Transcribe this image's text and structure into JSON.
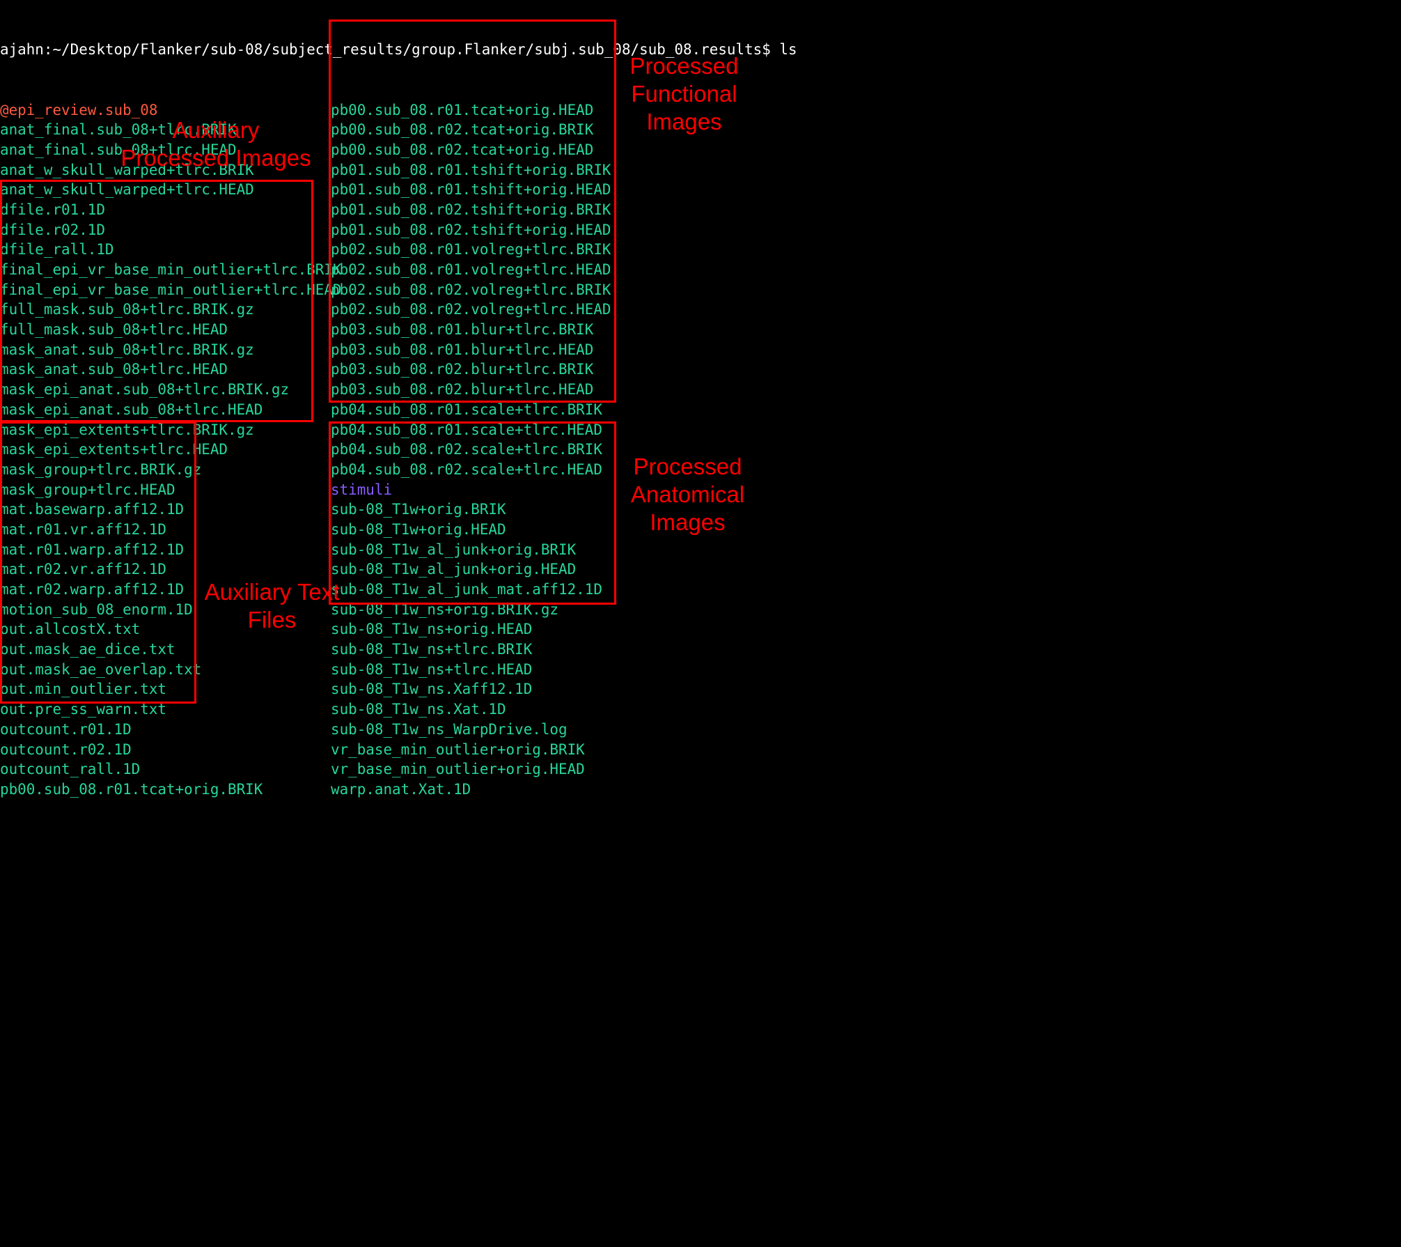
{
  "prompt": "ajahn:~/Desktop/Flanker/sub-08/subject_results/group.Flanker/subj.sub_08/sub_08.results$ ",
  "command": "ls",
  "col1": [
    {
      "t": "@epi_review.sub_08",
      "c": "exec"
    },
    {
      "t": "anat_final.sub_08+tlrc.BRIK",
      "c": "file"
    },
    {
      "t": "anat_final.sub_08+tlrc.HEAD",
      "c": "file"
    },
    {
      "t": "anat_w_skull_warped+tlrc.BRIK",
      "c": "file"
    },
    {
      "t": "anat_w_skull_warped+tlrc.HEAD",
      "c": "file"
    },
    {
      "t": "dfile.r01.1D",
      "c": "file"
    },
    {
      "t": "dfile.r02.1D",
      "c": "file"
    },
    {
      "t": "dfile_rall.1D",
      "c": "file"
    },
    {
      "t": "final_epi_vr_base_min_outlier+tlrc.BRIK",
      "c": "file"
    },
    {
      "t": "final_epi_vr_base_min_outlier+tlrc.HEAD",
      "c": "file"
    },
    {
      "t": "full_mask.sub_08+tlrc.BRIK.gz",
      "c": "file"
    },
    {
      "t": "full_mask.sub_08+tlrc.HEAD",
      "c": "file"
    },
    {
      "t": "mask_anat.sub_08+tlrc.BRIK.gz",
      "c": "file"
    },
    {
      "t": "mask_anat.sub_08+tlrc.HEAD",
      "c": "file"
    },
    {
      "t": "mask_epi_anat.sub_08+tlrc.BRIK.gz",
      "c": "file"
    },
    {
      "t": "mask_epi_anat.sub_08+tlrc.HEAD",
      "c": "file"
    },
    {
      "t": "mask_epi_extents+tlrc.BRIK.gz",
      "c": "file"
    },
    {
      "t": "mask_epi_extents+tlrc.HEAD",
      "c": "file"
    },
    {
      "t": "mask_group+tlrc.BRIK.gz",
      "c": "file"
    },
    {
      "t": "mask_group+tlrc.HEAD",
      "c": "file"
    },
    {
      "t": "mat.basewarp.aff12.1D",
      "c": "file"
    },
    {
      "t": "mat.r01.vr.aff12.1D",
      "c": "file"
    },
    {
      "t": "mat.r01.warp.aff12.1D",
      "c": "file"
    },
    {
      "t": "mat.r02.vr.aff12.1D",
      "c": "file"
    },
    {
      "t": "mat.r02.warp.aff12.1D",
      "c": "file"
    },
    {
      "t": "motion_sub_08_enorm.1D",
      "c": "file"
    },
    {
      "t": "out.allcostX.txt",
      "c": "file"
    },
    {
      "t": "out.mask_ae_dice.txt",
      "c": "file"
    },
    {
      "t": "out.mask_ae_overlap.txt",
      "c": "file"
    },
    {
      "t": "out.min_outlier.txt",
      "c": "file"
    },
    {
      "t": "out.pre_ss_warn.txt",
      "c": "file"
    },
    {
      "t": "outcount.r01.1D",
      "c": "file"
    },
    {
      "t": "outcount.r02.1D",
      "c": "file"
    },
    {
      "t": "outcount_rall.1D",
      "c": "file"
    },
    {
      "t": "pb00.sub_08.r01.tcat+orig.BRIK",
      "c": "file"
    }
  ],
  "col2": [
    {
      "t": "pb00.sub_08.r01.tcat+orig.HEAD",
      "c": "file"
    },
    {
      "t": "pb00.sub_08.r02.tcat+orig.BRIK",
      "c": "file"
    },
    {
      "t": "pb00.sub_08.r02.tcat+orig.HEAD",
      "c": "file"
    },
    {
      "t": "pb01.sub_08.r01.tshift+orig.BRIK",
      "c": "file"
    },
    {
      "t": "pb01.sub_08.r01.tshift+orig.HEAD",
      "c": "file"
    },
    {
      "t": "pb01.sub_08.r02.tshift+orig.BRIK",
      "c": "file"
    },
    {
      "t": "pb01.sub_08.r02.tshift+orig.HEAD",
      "c": "file"
    },
    {
      "t": "pb02.sub_08.r01.volreg+tlrc.BRIK",
      "c": "file"
    },
    {
      "t": "pb02.sub_08.r01.volreg+tlrc.HEAD",
      "c": "file"
    },
    {
      "t": "pb02.sub_08.r02.volreg+tlrc.BRIK",
      "c": "file"
    },
    {
      "t": "pb02.sub_08.r02.volreg+tlrc.HEAD",
      "c": "file"
    },
    {
      "t": "pb03.sub_08.r01.blur+tlrc.BRIK",
      "c": "file"
    },
    {
      "t": "pb03.sub_08.r01.blur+tlrc.HEAD",
      "c": "file"
    },
    {
      "t": "pb03.sub_08.r02.blur+tlrc.BRIK",
      "c": "file"
    },
    {
      "t": "pb03.sub_08.r02.blur+tlrc.HEAD",
      "c": "file"
    },
    {
      "t": "pb04.sub_08.r01.scale+tlrc.BRIK",
      "c": "file"
    },
    {
      "t": "pb04.sub_08.r01.scale+tlrc.HEAD",
      "c": "file"
    },
    {
      "t": "pb04.sub_08.r02.scale+tlrc.BRIK",
      "c": "file"
    },
    {
      "t": "pb04.sub_08.r02.scale+tlrc.HEAD",
      "c": "file"
    },
    {
      "t": "stimuli",
      "c": "dirclr"
    },
    {
      "t": "sub-08_T1w+orig.BRIK",
      "c": "file"
    },
    {
      "t": "sub-08_T1w+orig.HEAD",
      "c": "file"
    },
    {
      "t": "sub-08_T1w_al_junk+orig.BRIK",
      "c": "file"
    },
    {
      "t": "sub-08_T1w_al_junk+orig.HEAD",
      "c": "file"
    },
    {
      "t": "sub-08_T1w_al_junk_mat.aff12.1D",
      "c": "file"
    },
    {
      "t": "sub-08_T1w_ns+orig.BRIK.gz",
      "c": "file"
    },
    {
      "t": "sub-08_T1w_ns+orig.HEAD",
      "c": "file"
    },
    {
      "t": "sub-08_T1w_ns+tlrc.BRIK",
      "c": "file"
    },
    {
      "t": "sub-08_T1w_ns+tlrc.HEAD",
      "c": "file"
    },
    {
      "t": "sub-08_T1w_ns.Xaff12.1D",
      "c": "file"
    },
    {
      "t": "sub-08_T1w_ns.Xat.1D",
      "c": "file"
    },
    {
      "t": "sub-08_T1w_ns_WarpDrive.log",
      "c": "file"
    },
    {
      "t": "vr_base_min_outlier+orig.BRIK",
      "c": "file"
    },
    {
      "t": "vr_base_min_outlier+orig.HEAD",
      "c": "file"
    },
    {
      "t": "warp.anat.Xat.1D",
      "c": "file"
    }
  ],
  "labels": {
    "aux_proc": "Auxiliary Processed Images",
    "aux_text": "Auxiliary Text Files",
    "proc_func": "Processed Functional Images",
    "proc_anat": "Processed Anatomical Images"
  }
}
